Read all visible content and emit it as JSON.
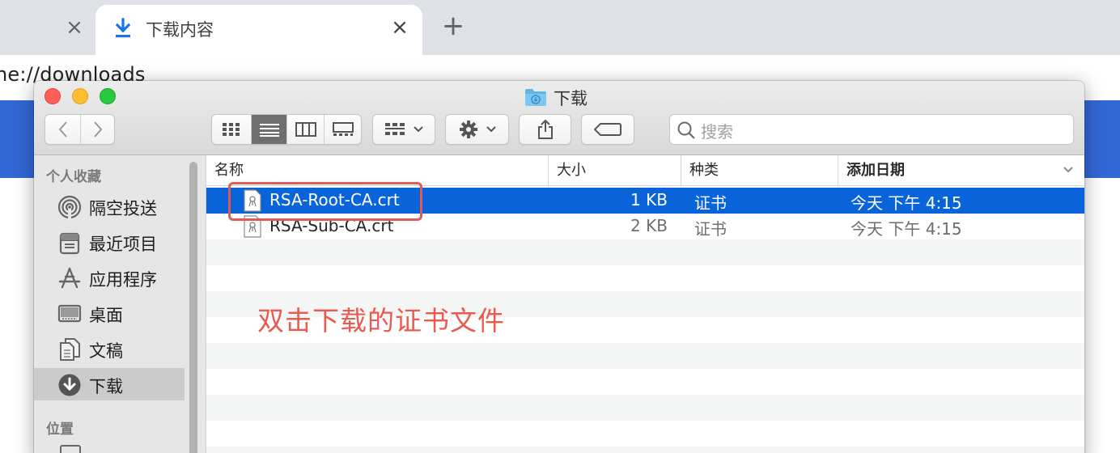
{
  "browser": {
    "prev_tab_close": "×",
    "tab": {
      "title": "下载内容",
      "close": "×",
      "icon": "download-arrow-icon"
    },
    "new_tab": "+",
    "url": "ne://downloads",
    "banner_color": "#3367d6"
  },
  "finder": {
    "title": "下载",
    "toolbar": {
      "search_placeholder": "搜索",
      "view_modes": [
        "icon-view",
        "list-view",
        "column-view",
        "gallery-view"
      ],
      "active_view": "list-view"
    },
    "sidebar": {
      "favorites_heading": "个人收藏",
      "items": [
        {
          "label": "隔空投送",
          "icon": "airdrop-icon"
        },
        {
          "label": "最近项目",
          "icon": "recents-icon"
        },
        {
          "label": "应用程序",
          "icon": "applications-icon"
        },
        {
          "label": "桌面",
          "icon": "desktop-icon"
        },
        {
          "label": "文稿",
          "icon": "documents-icon"
        },
        {
          "label": "下载",
          "icon": "downloads-icon",
          "selected": true
        }
      ],
      "locations_heading": "位置"
    },
    "columns": {
      "name": "名称",
      "size": "大小",
      "kind": "种类",
      "date": "添加日期"
    },
    "files": [
      {
        "name": "RSA-Root-CA.crt",
        "size": "1 KB",
        "kind": "证书",
        "date": "今天 下午 4:15",
        "selected": true
      },
      {
        "name": "RSA-Sub-CA.crt",
        "size": "2 KB",
        "kind": "证书",
        "date": "今天 下午 4:15",
        "selected": false
      }
    ]
  },
  "annotation": "双击下载的证书文件",
  "colors": {
    "selection": "#0a64d9",
    "annotation": "#ea5a4e"
  }
}
